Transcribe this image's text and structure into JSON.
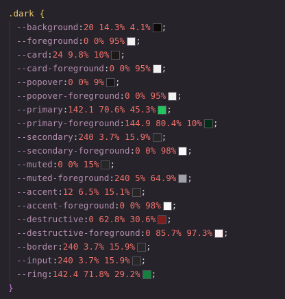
{
  "selector": ".dark",
  "open_brace": "{",
  "close_brace": "}",
  "declarations": [
    {
      "name": "--background",
      "value": "20 14.3% 4.1%",
      "swatch": "#0c0a09"
    },
    {
      "name": "--foreground",
      "value": "0 0% 95%",
      "swatch": "#f2f2f2"
    },
    {
      "name": "--card",
      "value": "24 9.8% 10%",
      "swatch": "#1c1917"
    },
    {
      "name": "--card-foreground",
      "value": "0 0% 95%",
      "swatch": "#f2f2f2"
    },
    {
      "name": "--popover",
      "value": "0 0% 9%",
      "swatch": "#171717"
    },
    {
      "name": "--popover-foreground",
      "value": "0 0% 95%",
      "swatch": "#f2f2f2"
    },
    {
      "name": "--primary",
      "value": "142.1 70.6% 45.3%",
      "swatch": "#22c55e"
    },
    {
      "name": "--primary-foreground",
      "value": "144.9 80.4% 10%",
      "swatch": "#052e16"
    },
    {
      "name": "--secondary",
      "value": "240 3.7% 15.9%",
      "swatch": "#27272a"
    },
    {
      "name": "--secondary-foreground",
      "value": "0 0% 98%",
      "swatch": "#fafafa"
    },
    {
      "name": "--muted",
      "value": "0 0% 15%",
      "swatch": "#262626"
    },
    {
      "name": "--muted-foreground",
      "value": "240 5% 64.9%",
      "swatch": "#a1a1aa"
    },
    {
      "name": "--accent",
      "value": "12 6.5% 15.1%",
      "swatch": "#292524"
    },
    {
      "name": "--accent-foreground",
      "value": "0 0% 98%",
      "swatch": "#fafafa"
    },
    {
      "name": "--destructive",
      "value": "0 62.8% 30.6%",
      "swatch": "#7f1d1d"
    },
    {
      "name": "--destructive-foreground",
      "value": "0 85.7% 97.3%",
      "swatch": "#fef2f2"
    },
    {
      "name": "--border",
      "value": "240 3.7% 15.9%",
      "swatch": "#27272a"
    },
    {
      "name": "--input",
      "value": "240 3.7% 15.9%",
      "swatch": "#27272a"
    },
    {
      "name": "--ring",
      "value": "142.4 71.8% 29.2%",
      "swatch": "#15803d"
    }
  ]
}
